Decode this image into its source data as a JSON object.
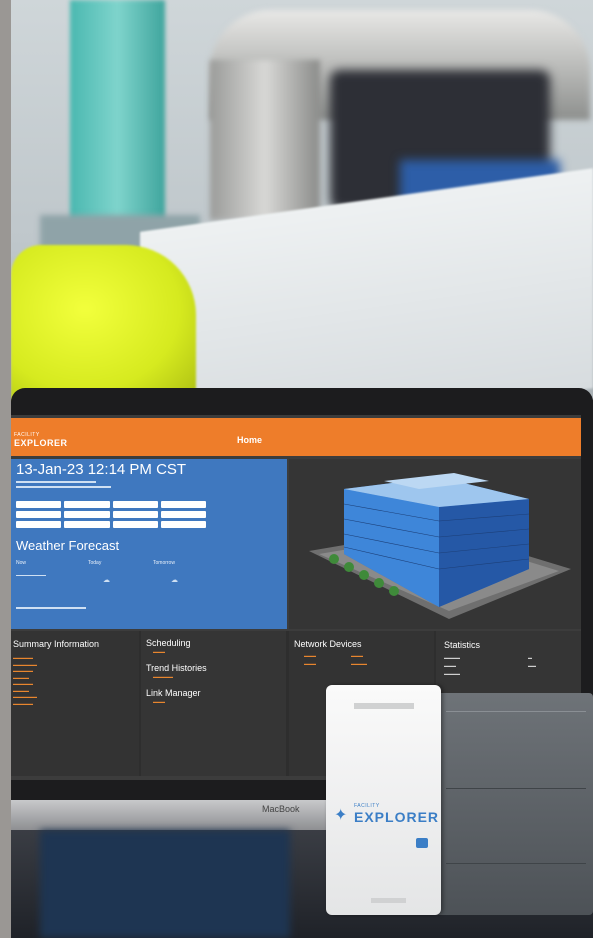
{
  "laptop": {
    "brand": "MacBook"
  },
  "app": {
    "logo_small": "FACILITY",
    "logo": "EXPLORER",
    "nav_title": "Home",
    "datetime": "13-Jan-23 12:14 PM CST",
    "weather_title": "Weather Forecast",
    "weather_cols": [
      "Now",
      "Today",
      "Tomorrow"
    ],
    "sections": {
      "summary": "Summary Information",
      "scheduling": "Scheduling",
      "trend": "Trend Histories",
      "link": "Link Manager",
      "network": "Network Devices",
      "statistics": "Statistics"
    }
  },
  "device": {
    "logo_small": "FACILITY",
    "logo": "EXPLORER"
  },
  "colors": {
    "orange": "#ee7d2a",
    "blue_panel": "#3f78bf",
    "device_blue": "#3b7ec6"
  }
}
